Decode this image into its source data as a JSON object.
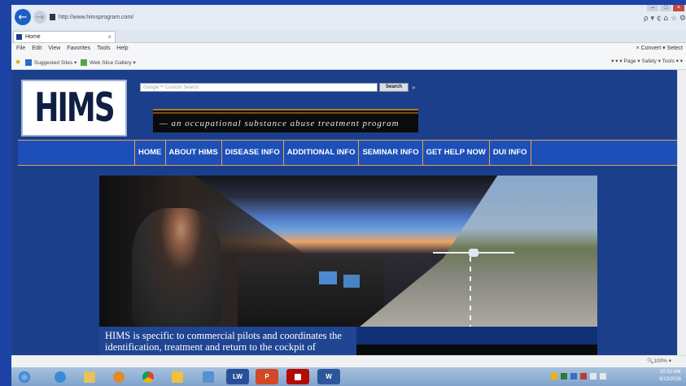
{
  "browser": {
    "url": "http://www.himsprogram.com/",
    "tab_title": "Home",
    "tab_close": "×",
    "address_tools": "ρ ▾ ¢   ⌂ ☆ ⚙",
    "menu": [
      "File",
      "Edit",
      "View",
      "Favorites",
      "Tools",
      "Help"
    ],
    "menu_right": "×  Convert ▾  Select",
    "favorites": [
      "Suggested Sites ▾",
      "Web Slice Gallery ▾"
    ],
    "command_bar": "▾ ▾ ▾ Page ▾  Safety ▾  Tools ▾ ▾",
    "zoom": "100%",
    "zoom_arrow": "▾"
  },
  "site": {
    "logo_text": "HIMS",
    "search_placeholder": "Google™ Custom Search",
    "search_button": "Search",
    "search_extra": "»",
    "tagline": "— an occupational substance abuse treatment program",
    "nav": [
      "HOME",
      "ABOUT HIMS",
      "DISEASE INFO",
      "ADDITIONAL INFO",
      "SEMINAR INFO",
      "GET HELP NOW",
      "DUI INFO"
    ],
    "intro_text": "HIMS is specific to commercial pilots and coordinates the identification, treatment and return to the cockpit of"
  },
  "taskbar": {
    "apps": [
      "start",
      "ie",
      "explorer",
      "media",
      "chrome",
      "outlook",
      "network",
      "lw",
      "powerpoint",
      "acrobat",
      "word"
    ],
    "app_labels": [
      "",
      "",
      "",
      "",
      "",
      "",
      "",
      "LW",
      "P",
      "",
      "W"
    ],
    "clock_time": "10:32 AM",
    "clock_date": "6/13/2016"
  },
  "colors": {
    "slide_bg": "#1d43a6",
    "page_bg": "#1b3f8b",
    "nav_bg": "#1d4fb8",
    "nav_border": "#e3a24a"
  }
}
